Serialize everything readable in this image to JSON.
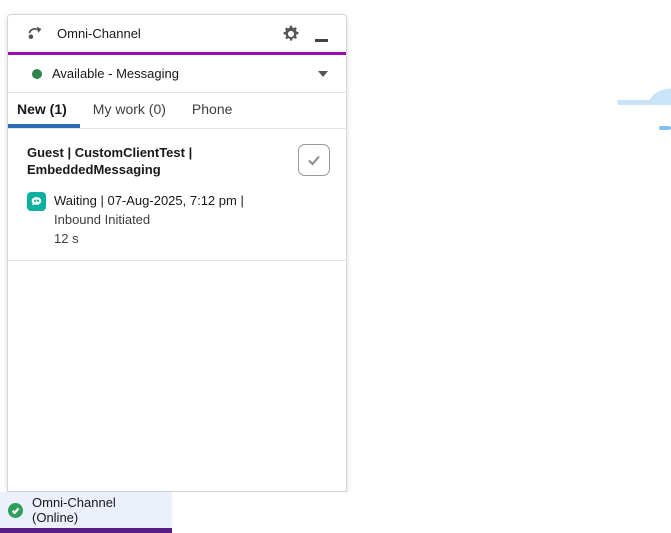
{
  "panel": {
    "header": {
      "title": "Omni-Channel"
    },
    "status": {
      "label": "Available - Messaging"
    },
    "tabs": [
      {
        "label": "New (1)"
      },
      {
        "label": "My work (0)"
      },
      {
        "label": "Phone"
      }
    ],
    "work_item": {
      "title": "Guest | CustomClientTest | EmbeddedMessaging",
      "status_line": "Waiting | 07-Aug-2025, 7:12 pm |",
      "detail": "Inbound Initiated",
      "timer": "12 s"
    }
  },
  "utility_bar": {
    "item_label": "Omni-Channel (Online)"
  },
  "colors": {
    "header_accent": "#9a0bb0",
    "tab_active": "#2b6cb8",
    "status_dot": "#2e844a",
    "channel_icon_bg": "#0eb0a0",
    "utility_active": "#571d86",
    "utility_bg": "#ecf0fb",
    "utility_check": "#2e9e5b",
    "cloud": "#c9e3f8",
    "cloud_dash": "#85bfed"
  }
}
